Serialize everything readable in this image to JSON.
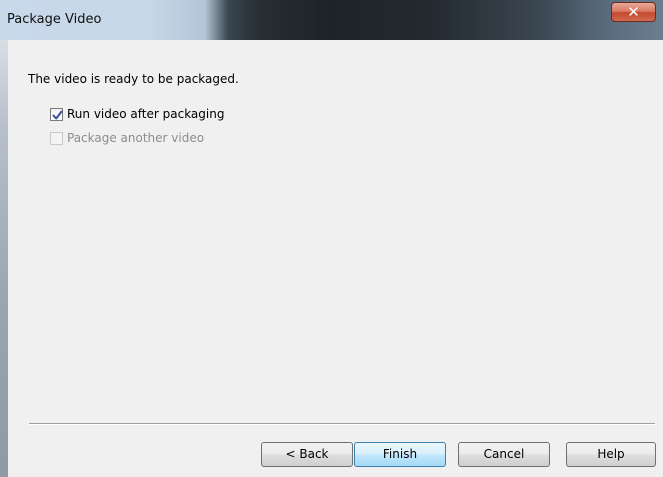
{
  "window": {
    "title": "Package Video",
    "close_glyph": "✕"
  },
  "content": {
    "message": "The video is ready to be packaged.",
    "options": [
      {
        "label": "Run video after packaging",
        "checked": true,
        "enabled": true
      },
      {
        "label": "Package another video",
        "checked": false,
        "enabled": false
      }
    ]
  },
  "buttons": {
    "back": "< Back",
    "finish": "Finish",
    "cancel": "Cancel",
    "help": "Help"
  },
  "icons": {
    "close": "close-icon",
    "check": "checkmark-icon"
  },
  "colors": {
    "default_button_border": "#3c7fb1",
    "close_button": "#c4492f",
    "check_mark": "#3b4f9a",
    "disabled_text": "#8d8d8d"
  }
}
